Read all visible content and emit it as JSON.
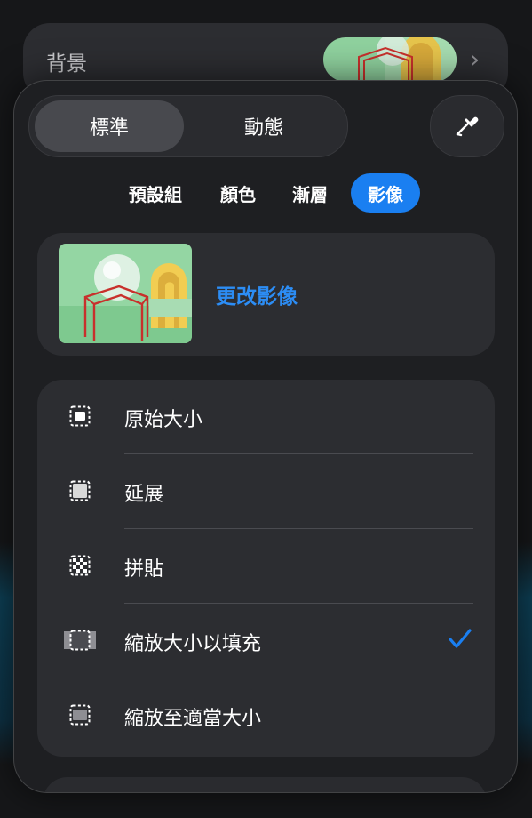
{
  "background_row": {
    "label": "背景"
  },
  "mode_switch": {
    "options": [
      "標準",
      "動態"
    ],
    "selected": "標準"
  },
  "fill_tabs": {
    "items": [
      "預設組",
      "顏色",
      "漸層",
      "影像"
    ],
    "active": "影像"
  },
  "image_card": {
    "change_label": "更改影像"
  },
  "scale_options": {
    "items": [
      {
        "label": "原始大小",
        "icon": "original-size-icon"
      },
      {
        "label": "延展",
        "icon": "stretch-icon"
      },
      {
        "label": "拼貼",
        "icon": "tile-icon"
      },
      {
        "label": "縮放大小以填充",
        "icon": "scale-to-fill-icon"
      },
      {
        "label": "縮放至適當大小",
        "icon": "scale-to-fit-icon"
      }
    ],
    "selected": "縮放大小以填充"
  },
  "colors": {
    "accent": "#1a7ff1",
    "link": "#2c8df5",
    "panel": "#2c2d31"
  }
}
